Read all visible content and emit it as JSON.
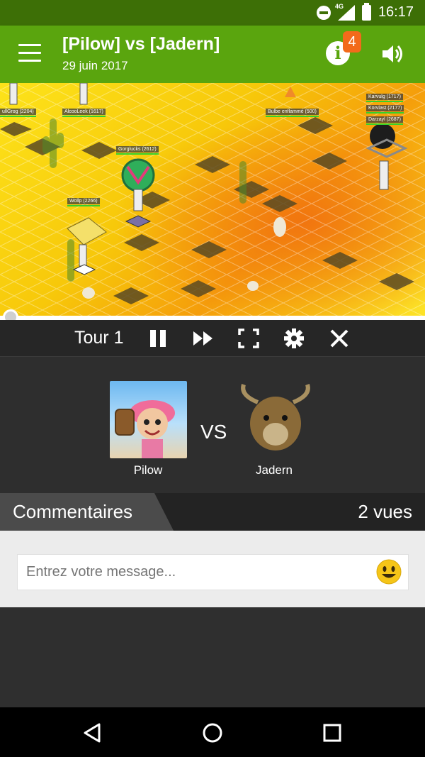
{
  "status_bar": {
    "time": "16:17",
    "network": "4G",
    "icons": [
      "do-not-disturb-icon",
      "signal-icon",
      "battery-icon"
    ]
  },
  "app_bar": {
    "title": "[Pilow] vs [Jadern]",
    "date": "29 juin 2017",
    "notification_count": "4",
    "icons": [
      "menu-icon",
      "info-icon",
      "volume-icon"
    ],
    "color": "#5aa50e"
  },
  "fight": {
    "players": [
      {
        "label": "ullGrog (2204)"
      },
      {
        "label": "AlcooLeek (1617)"
      },
      {
        "label": "Bulbe enflammé (500)"
      },
      {
        "label": "Karvulg (1717)"
      },
      {
        "label": "Korvlast (2177)"
      },
      {
        "label": "Darzayl (2687)"
      },
      {
        "label": "Gorglucks (2612)"
      },
      {
        "label": "Wollp (2266)"
      }
    ],
    "progress": 0.0
  },
  "controls": {
    "turn_label": "Tour 1",
    "icons": [
      "pause-icon",
      "fast-forward-icon",
      "fullscreen-icon",
      "settings-icon",
      "close-icon"
    ]
  },
  "duel": {
    "left_name": "Pilow",
    "vs": "VS",
    "right_name": "Jadern"
  },
  "comments": {
    "tab_label": "Commentaires",
    "views": "2 vues",
    "placeholder": "Entrez votre message..."
  },
  "nav_bar": {
    "icons": [
      "back-icon",
      "home-icon",
      "recents-icon"
    ]
  }
}
